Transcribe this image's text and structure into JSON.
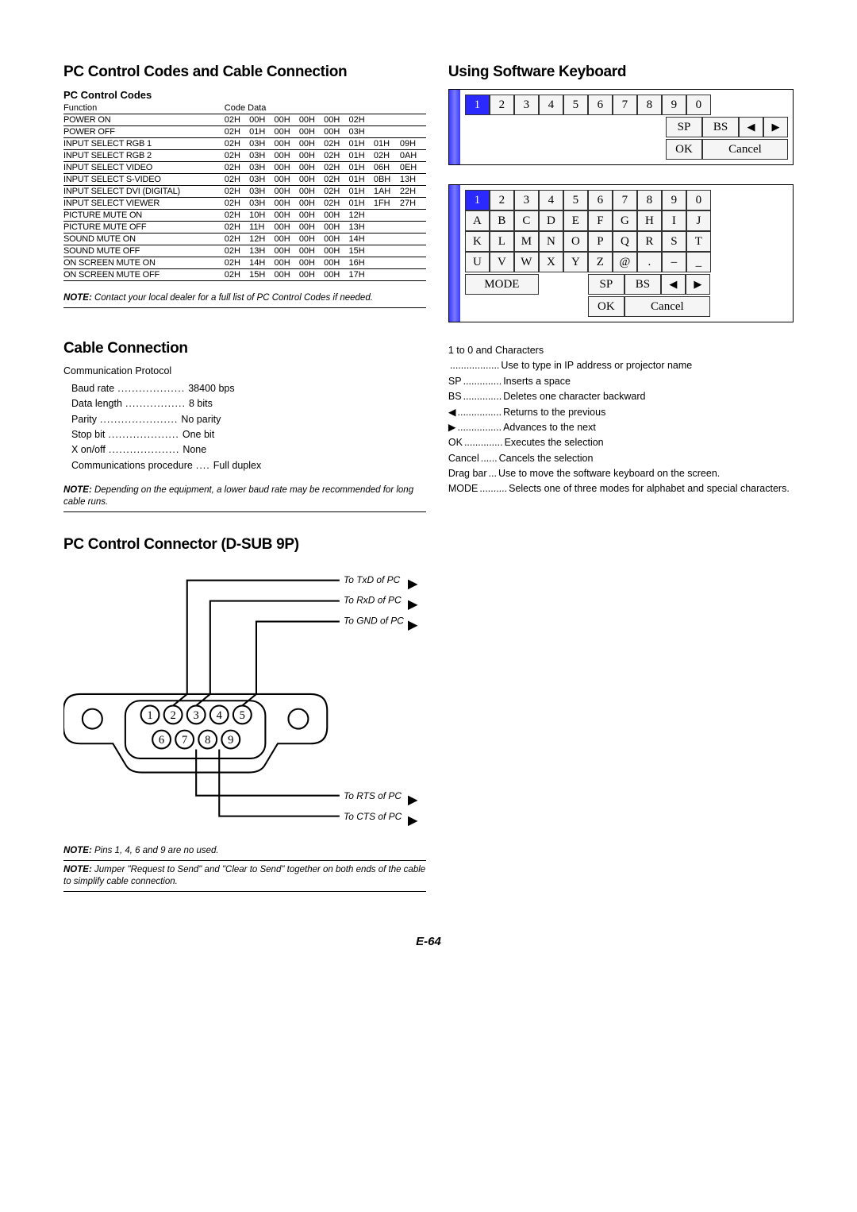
{
  "left": {
    "title1": "PC Control Codes and Cable Connection",
    "subhead_codes": "PC Control Codes",
    "codes_header": {
      "fn": "Function",
      "cd": "Code Data"
    },
    "codes": [
      {
        "fn": "POWER ON",
        "d": [
          "02H",
          "00H",
          "00H",
          "00H",
          "00H",
          "02H",
          "",
          ""
        ]
      },
      {
        "fn": "POWER OFF",
        "d": [
          "02H",
          "01H",
          "00H",
          "00H",
          "00H",
          "03H",
          "",
          ""
        ]
      },
      {
        "fn": "INPUT SELECT RGB 1",
        "d": [
          "02H",
          "03H",
          "00H",
          "00H",
          "02H",
          "01H",
          "01H",
          "09H"
        ]
      },
      {
        "fn": "INPUT SELECT RGB 2",
        "d": [
          "02H",
          "03H",
          "00H",
          "00H",
          "02H",
          "01H",
          "02H",
          "0AH"
        ]
      },
      {
        "fn": "INPUT SELECT VIDEO",
        "d": [
          "02H",
          "03H",
          "00H",
          "00H",
          "02H",
          "01H",
          "06H",
          "0EH"
        ]
      },
      {
        "fn": "INPUT SELECT S-VIDEO",
        "d": [
          "02H",
          "03H",
          "00H",
          "00H",
          "02H",
          "01H",
          "0BH",
          "13H"
        ]
      },
      {
        "fn": "INPUT SELECT DVI (DIGITAL)",
        "d": [
          "02H",
          "03H",
          "00H",
          "00H",
          "02H",
          "01H",
          "1AH",
          "22H"
        ]
      },
      {
        "fn": "INPUT SELECT VIEWER",
        "d": [
          "02H",
          "03H",
          "00H",
          "00H",
          "02H",
          "01H",
          "1FH",
          "27H"
        ]
      },
      {
        "fn": "PICTURE MUTE ON",
        "d": [
          "02H",
          "10H",
          "00H",
          "00H",
          "00H",
          "12H",
          "",
          ""
        ]
      },
      {
        "fn": "PICTURE MUTE OFF",
        "d": [
          "02H",
          "11H",
          "00H",
          "00H",
          "00H",
          "13H",
          "",
          ""
        ]
      },
      {
        "fn": "SOUND MUTE ON",
        "d": [
          "02H",
          "12H",
          "00H",
          "00H",
          "00H",
          "14H",
          "",
          ""
        ]
      },
      {
        "fn": "SOUND MUTE OFF",
        "d": [
          "02H",
          "13H",
          "00H",
          "00H",
          "00H",
          "15H",
          "",
          ""
        ]
      },
      {
        "fn": "ON SCREEN MUTE ON",
        "d": [
          "02H",
          "14H",
          "00H",
          "00H",
          "00H",
          "16H",
          "",
          ""
        ]
      },
      {
        "fn": "ON SCREEN MUTE OFF",
        "d": [
          "02H",
          "15H",
          "00H",
          "00H",
          "00H",
          "17H",
          "",
          ""
        ]
      }
    ],
    "note_codes": "Contact your local dealer for a full list of PC Control Codes if needed.",
    "title_cable": "Cable Connection",
    "comm_label": "Communication Protocol",
    "comm": [
      {
        "label": "Baud rate",
        "value": "38400 bps"
      },
      {
        "label": "Data length",
        "value": "8 bits"
      },
      {
        "label": "Parity",
        "value": "No parity"
      },
      {
        "label": "Stop bit",
        "value": "One bit"
      },
      {
        "label": "X on/off",
        "value": "None"
      },
      {
        "label": "Communications procedure",
        "value": "Full duplex"
      }
    ],
    "note_baud": "Depending on the equipment, a lower baud rate may be recommended for long cable runs.",
    "title_connector": "PC Control Connector (D-SUB 9P)",
    "pin_labels": {
      "txd": "To TxD of PC",
      "rxd": "To RxD of PC",
      "gnd": "To GND of PC",
      "rts": "To RTS of PC",
      "cts": "To CTS of PC"
    },
    "note_pins": "Pins 1, 4, 6 and 9 are no used.",
    "note_jumper": "Jumper \"Request to Send\" and \"Clear to Send\" together on both ends of the cable to simplify cable connection."
  },
  "right": {
    "title": "Using Software Keyboard",
    "kbd1": {
      "rows": [
        [
          "1",
          "2",
          "3",
          "4",
          "5",
          "6",
          "7",
          "8",
          "9",
          "0"
        ]
      ],
      "selected": [
        0,
        0
      ],
      "bottom": {
        "sp": "SP",
        "bs": "BS",
        "left": "◀",
        "right": "▶",
        "ok": "OK",
        "cancel": "Cancel"
      }
    },
    "kbd2": {
      "rows": [
        [
          "1",
          "2",
          "3",
          "4",
          "5",
          "6",
          "7",
          "8",
          "9",
          "0"
        ],
        [
          "A",
          "B",
          "C",
          "D",
          "E",
          "F",
          "G",
          "H",
          "I",
          "J"
        ],
        [
          "K",
          "L",
          "M",
          "N",
          "O",
          "P",
          "Q",
          "R",
          "S",
          "T"
        ],
        [
          "U",
          "V",
          "W",
          "X",
          "Y",
          "Z",
          "@",
          ".",
          "–",
          "_"
        ]
      ],
      "selected": [
        0,
        0
      ],
      "bottom": {
        "mode": "MODE",
        "sp": "SP",
        "bs": "BS",
        "left": "◀",
        "right": "▶",
        "ok": "OK",
        "cancel": "Cancel"
      }
    },
    "keydesc_intro": "1 to 0 and Characters",
    "keydesc": [
      {
        "label": "",
        "desc": "Use to type in IP address or projector name"
      },
      {
        "label": "SP",
        "desc": "Inserts a space"
      },
      {
        "label": "BS",
        "desc": "Deletes one character backward"
      },
      {
        "label": "◀",
        "desc": "Returns to the previous"
      },
      {
        "label": "▶",
        "desc": "Advances to the next"
      },
      {
        "label": "OK",
        "desc": "Executes the selection"
      },
      {
        "label": "Cancel",
        "desc": "Cancels the selection"
      },
      {
        "label": "Drag bar",
        "desc": "Use to move the software keyboard on the screen."
      },
      {
        "label": "MODE",
        "desc": "Selects one of three modes for alphabet and special characters."
      }
    ]
  },
  "footer": "E-64",
  "note_prefix": "NOTE:"
}
